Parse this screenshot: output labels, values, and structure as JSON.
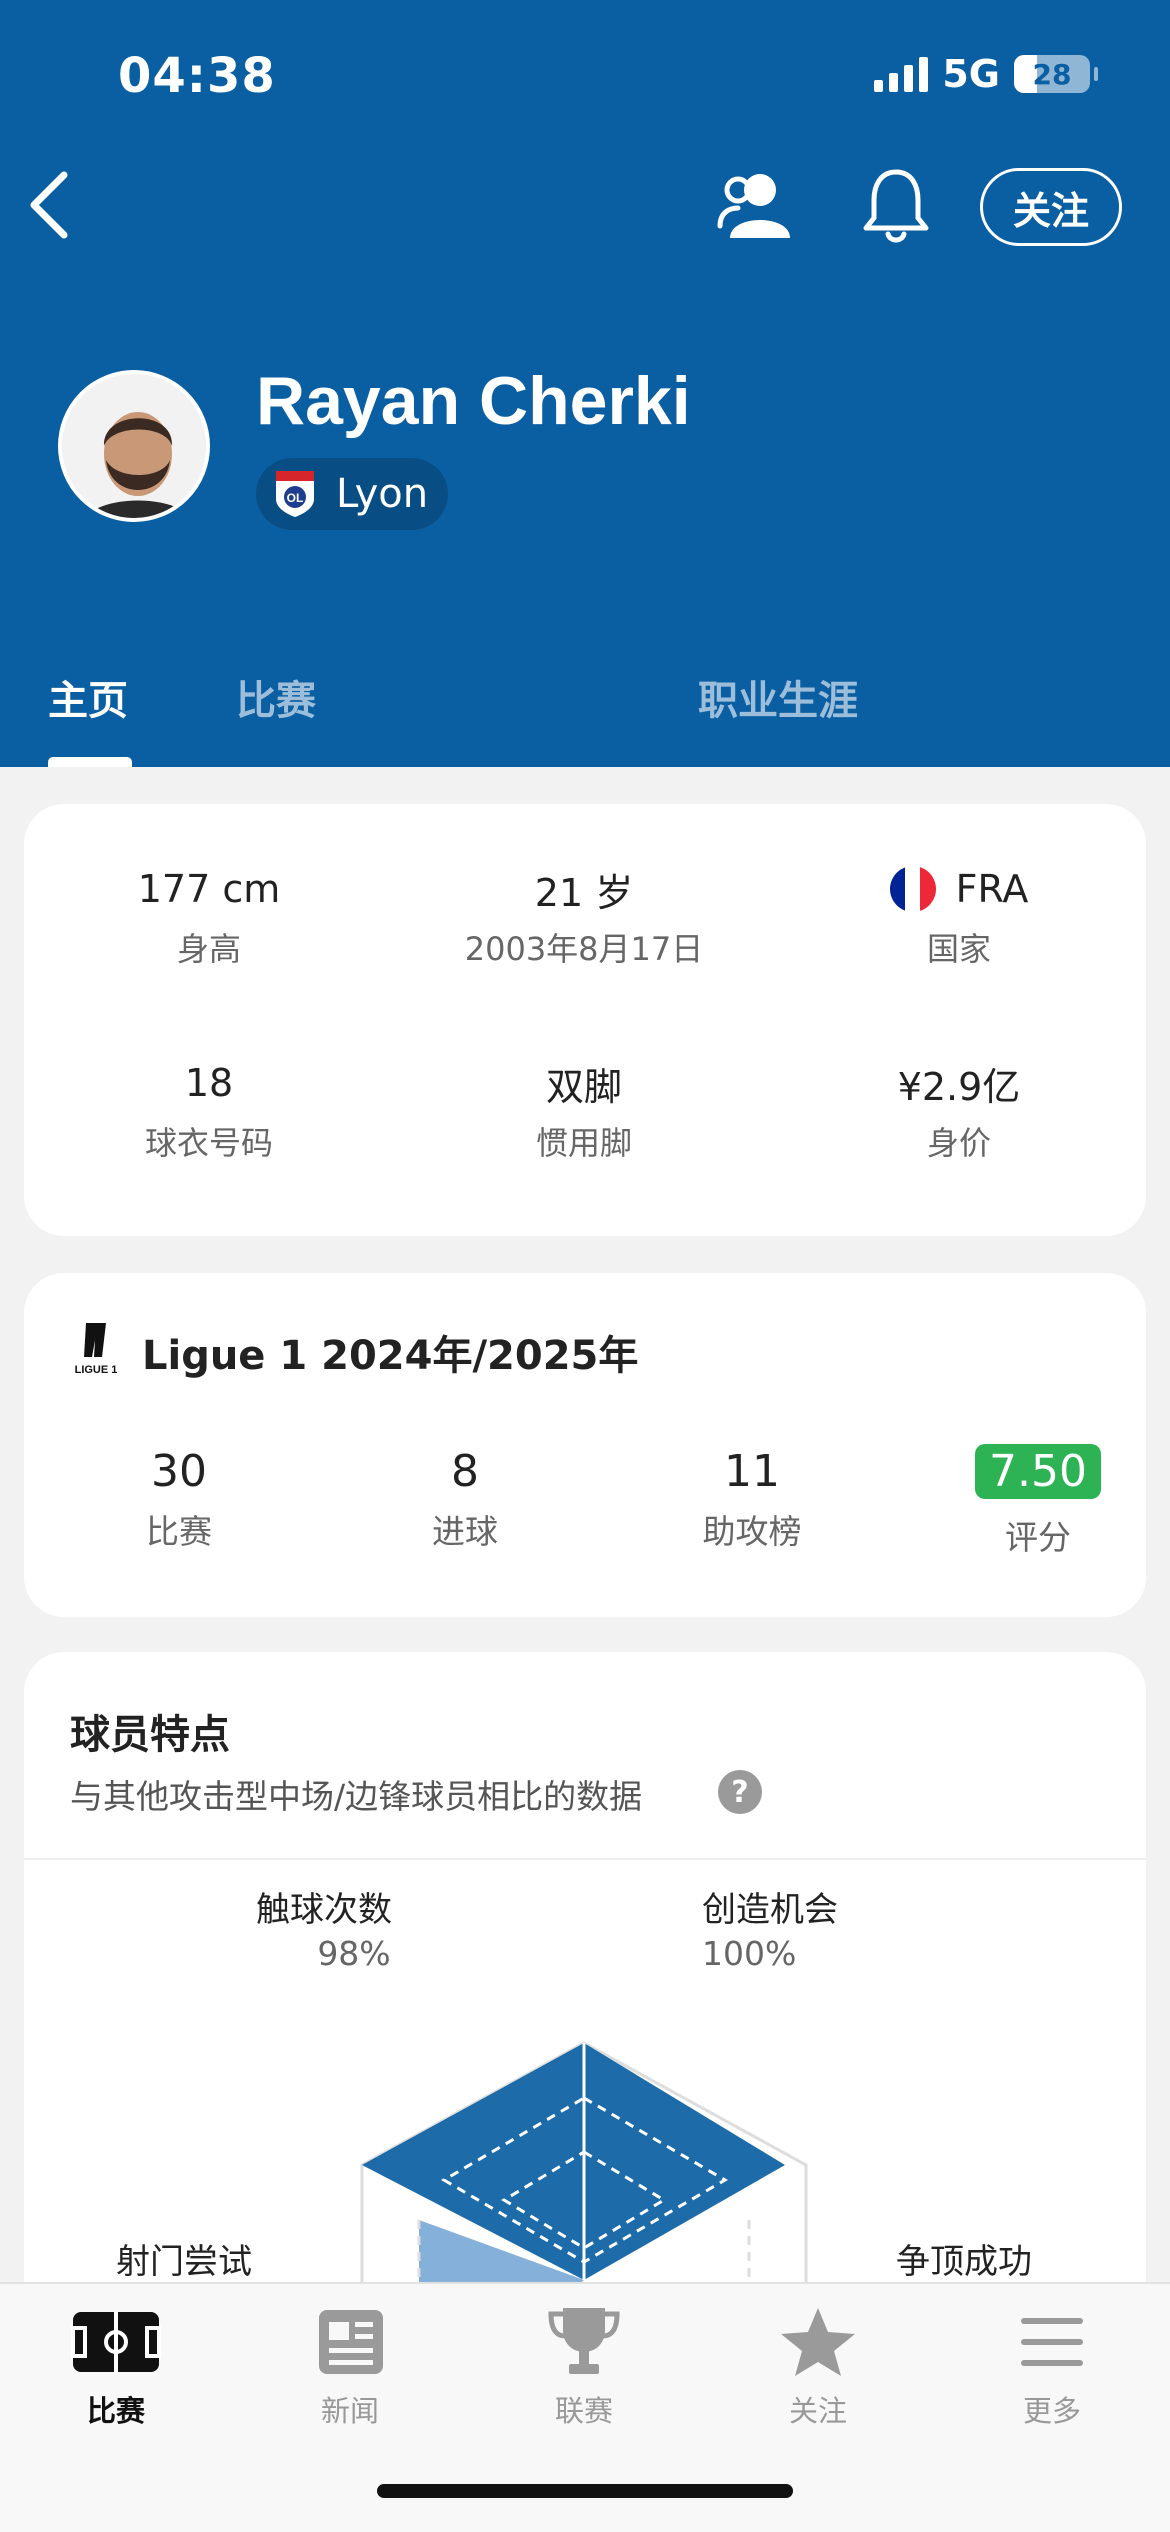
{
  "status_bar": {
    "time": "04:38",
    "network": "5G",
    "battery": "28"
  },
  "header": {
    "follow_label": "关注",
    "player_name": "Rayan Cherki",
    "club_name": "Lyon",
    "club_badge_text": "OL"
  },
  "tabs": [
    {
      "label": "主页",
      "active": true
    },
    {
      "label": "比赛",
      "active": false
    },
    {
      "label": "职业生涯",
      "active": false
    }
  ],
  "info": [
    {
      "value": "177 cm",
      "label": "身高"
    },
    {
      "value": "21 岁",
      "label": "2003年8月17日"
    },
    {
      "value": "FRA",
      "label": "国家",
      "flag": [
        "#002395",
        "#ffffff",
        "#ed2939"
      ]
    },
    {
      "value": "18",
      "label": "球衣号码"
    },
    {
      "value": "双脚",
      "label": "惯用脚"
    },
    {
      "value": "¥2.9亿",
      "label": "身价"
    }
  ],
  "league": {
    "logo_text": "LIGUE 1",
    "title": "Ligue 1 2024年/2025年",
    "stats": [
      {
        "value": "30",
        "label": "比赛"
      },
      {
        "value": "8",
        "label": "进球"
      },
      {
        "value": "11",
        "label": "助攻榜"
      },
      {
        "value": "7.50",
        "label": "评分",
        "highlight": "#2db354"
      }
    ]
  },
  "traits": {
    "title": "球员特点",
    "subtitle": "与其他攻击型中场/边锋球员相比的数据",
    "help_icon": "?",
    "attributes": [
      {
        "label": "触球次数",
        "percent": "98%"
      },
      {
        "label": "创造机会",
        "percent": "100%"
      },
      {
        "label": "射门尝试",
        "percent": ""
      },
      {
        "label": "争顶成功",
        "percent": ""
      }
    ]
  },
  "bottom_nav": [
    {
      "label": "比赛",
      "icon": "pitch-icon",
      "active": true
    },
    {
      "label": "新闻",
      "icon": "news-icon",
      "active": false
    },
    {
      "label": "联赛",
      "icon": "trophy-icon",
      "active": false
    },
    {
      "label": "关注",
      "icon": "star-icon",
      "active": false
    },
    {
      "label": "更多",
      "icon": "menu-icon",
      "active": false
    }
  ],
  "colors": {
    "brand": "#0a5ea2",
    "rating": "#2db354",
    "radar_fill": "#0a5ea2"
  }
}
